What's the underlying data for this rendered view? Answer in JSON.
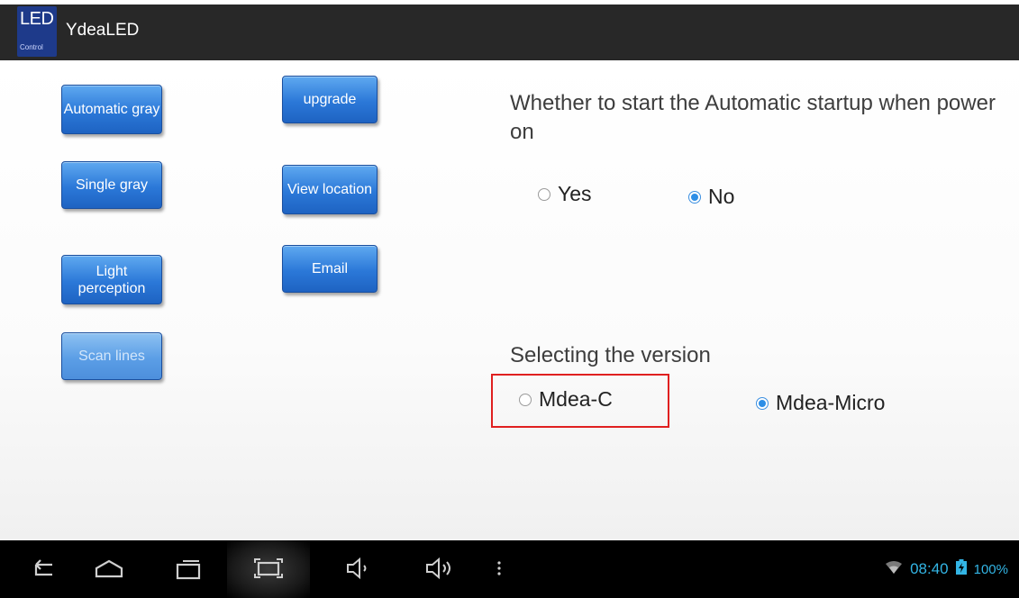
{
  "app": {
    "icon_text": "LED",
    "icon_subtext": "Control",
    "title": "YdeaLED"
  },
  "buttons": {
    "automatic_gray": "Automatic gray",
    "upgrade": "upgrade",
    "single_gray": "Single gray",
    "view_location": "View location",
    "light_perception": "Light perception",
    "email": "Email",
    "scan_lines": "Scan lines"
  },
  "startup": {
    "question": "Whether to start the Automatic startup when power on",
    "options": [
      {
        "label": "Yes",
        "selected": false
      },
      {
        "label": "No",
        "selected": true
      }
    ]
  },
  "version": {
    "question": "Selecting the version",
    "options": [
      {
        "label": "Mdea-C",
        "selected": false
      },
      {
        "label": "Mdea-Micro",
        "selected": true
      }
    ]
  },
  "navbar": {
    "icons": [
      "back-icon",
      "home-icon",
      "recent-apps-icon",
      "screenshot-icon",
      "volume-down-icon",
      "volume-up-icon",
      "menu-icon"
    ]
  },
  "status": {
    "time": "08:40",
    "battery": "100%"
  },
  "colors": {
    "accent": "#33b5e5",
    "button": "#2b78d8",
    "highlight": "#e02020"
  }
}
